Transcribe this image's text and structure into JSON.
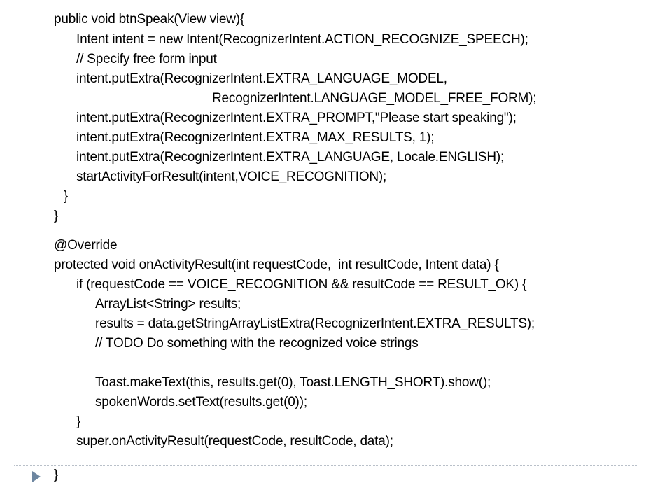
{
  "code": {
    "lines": [
      "public void btnSpeak(View view){",
      "Intent intent = new Intent(RecognizerIntent.ACTION_RECOGNIZE_SPEECH);",
      "// Specify free form input",
      "intent.putExtra(RecognizerIntent.EXTRA_LANGUAGE_MODEL,",
      "RecognizerIntent.LANGUAGE_MODEL_FREE_FORM);",
      "intent.putExtra(RecognizerIntent.EXTRA_PROMPT,\"Please start speaking\");",
      "intent.putExtra(RecognizerIntent.EXTRA_MAX_RESULTS, 1);",
      "intent.putExtra(RecognizerIntent.EXTRA_LANGUAGE, Locale.ENGLISH);",
      "startActivityForResult(intent,VOICE_RECOGNITION);",
      "}",
      "}",
      "@Override",
      "protected void onActivityResult(int requestCode,  int resultCode, Intent data) {",
      "if (requestCode == VOICE_RECOGNITION && resultCode == RESULT_OK) {",
      "ArrayList<String> results;",
      "results = data.getStringArrayListExtra(RecognizerIntent.EXTRA_RESULTS);",
      "// TODO Do something with the recognized voice strings",
      "Toast.makeText(this, results.get(0), Toast.LENGTH_SHORT).show();",
      "spokenWords.setText(results.get(0));",
      "}",
      "super.onActivityResult(requestCode, resultCode, data);",
      "}"
    ]
  },
  "colors": {
    "text": "#000000",
    "bullet": "#6d86a0",
    "divider": "#b9c0c9"
  },
  "icons": {
    "bullet": "triangle-bullet-icon"
  }
}
